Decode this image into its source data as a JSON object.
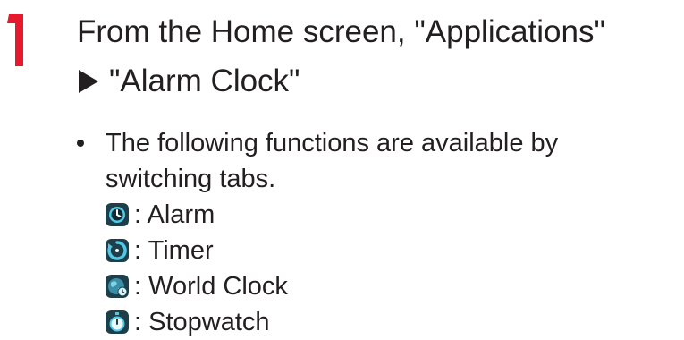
{
  "step": {
    "number": "1",
    "color": "#e8192c",
    "heading_line1": "From the Home screen, \"Applications\"",
    "heading_line2": "\"Alarm Clock\""
  },
  "bullet": {
    "text": "The following functions are available by switching tabs."
  },
  "tabs": [
    {
      "icon": "alarm-clock-icon",
      "label": ": Alarm"
    },
    {
      "icon": "timer-icon",
      "label": ": Timer"
    },
    {
      "icon": "world-clock-icon",
      "label": ": World Clock"
    },
    {
      "icon": "stopwatch-icon",
      "label": ": Stopwatch"
    }
  ],
  "colors": {
    "icon_bg": "#1d3f4a",
    "icon_accent": "#52c7e6"
  }
}
